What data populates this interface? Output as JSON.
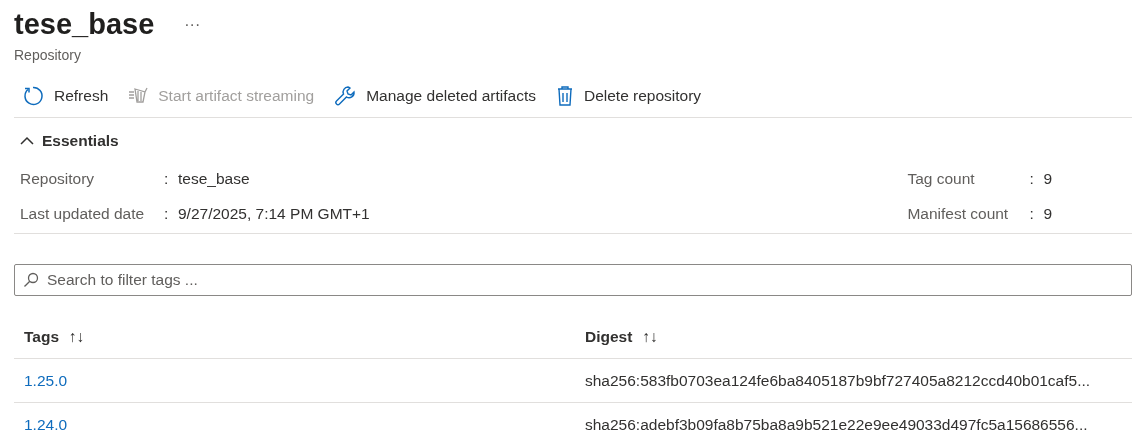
{
  "header": {
    "title": "tese_base",
    "more": "···",
    "subtitle": "Repository"
  },
  "toolbar": [
    {
      "kind": "refresh",
      "label": "Refresh",
      "disabled": false
    },
    {
      "kind": "streaming",
      "label": "Start artifact streaming",
      "disabled": true
    },
    {
      "kind": "wrench",
      "label": "Manage deleted artifacts",
      "disabled": false
    },
    {
      "kind": "trash",
      "label": "Delete repository",
      "disabled": false
    }
  ],
  "essentials": {
    "label": "Essentials",
    "expanded": true,
    "left": [
      {
        "label": "Repository",
        "separator": ":",
        "value": "tese_base"
      },
      {
        "label": "Last updated date",
        "separator": ":",
        "value": "9/27/2025, 7:14 PM GMT+1"
      }
    ],
    "right": [
      {
        "label": "Tag count",
        "separator": ":",
        "value": "9"
      },
      {
        "label": "Manifest count",
        "separator": ":",
        "value": "9"
      }
    ]
  },
  "search": {
    "placeholder": "Search to filter tags ..."
  },
  "table": {
    "columns": [
      {
        "label": "Tags",
        "sort": "↑↓"
      },
      {
        "label": "Digest",
        "sort": "↑↓"
      }
    ],
    "rows": [
      {
        "tag": "1.25.0",
        "digest": "sha256:583fb0703ea124fe6ba8405187b9bf727405a8212ccd40b01caf5..."
      },
      {
        "tag": "1.24.0",
        "digest": "sha256:adebf3b09fa8b75ba8a9b521e22e9ee49033d497fc5a15686556..."
      }
    ]
  }
}
